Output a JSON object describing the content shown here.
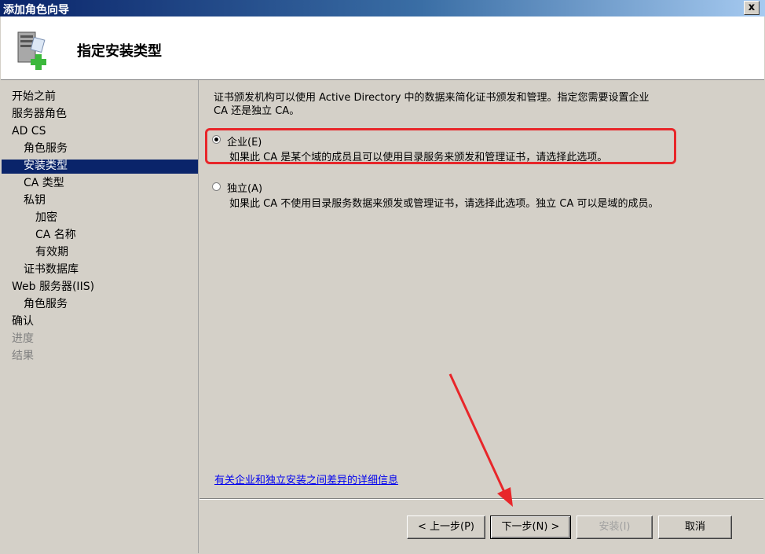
{
  "window": {
    "title": "添加角色向导",
    "close_label": "x"
  },
  "header": {
    "title": "指定安装类型",
    "icon": "server-add-icon"
  },
  "sidebar": {
    "items": [
      {
        "label": "开始之前"
      },
      {
        "label": "服务器角色"
      },
      {
        "label": "AD CS"
      },
      {
        "label": "角色服务"
      },
      {
        "label": "安装类型",
        "selected": true
      },
      {
        "label": "CA 类型"
      },
      {
        "label": "私钥"
      },
      {
        "label": "加密"
      },
      {
        "label": "CA 名称"
      },
      {
        "label": "有效期"
      },
      {
        "label": "证书数据库"
      },
      {
        "label": "Web 服务器(IIS)"
      },
      {
        "label": "角色服务"
      },
      {
        "label": "确认"
      },
      {
        "label": "进度",
        "disabled": true
      },
      {
        "label": "结果",
        "disabled": true
      }
    ]
  },
  "main": {
    "description": "证书颁发机构可以使用 Active Directory 中的数据来简化证书颁发和管理。指定您需要设置企业\nCA 还是独立 CA。",
    "options": [
      {
        "label": "企业(E)",
        "description": "如果此 CA 是某个域的成员且可以使用目录服务来颁发和管理证书，请选择此选项。",
        "selected": true
      },
      {
        "label": "独立(A)",
        "description": "如果此 CA 不使用目录服务数据来颁发或管理证书，请选择此选项。独立 CA 可以是域的成员。",
        "selected": false
      }
    ],
    "more_info_link": "有关企业和独立安装之间差异的详细信息"
  },
  "buttons": {
    "back": "< 上一步(P)",
    "next": "下一步(N) >",
    "install": "安装(I)",
    "cancel": "取消"
  },
  "colors": {
    "titlebar": "#0a246a",
    "selection": "#0a246a",
    "annotation": "#e8262a",
    "link": "#0000ee"
  }
}
